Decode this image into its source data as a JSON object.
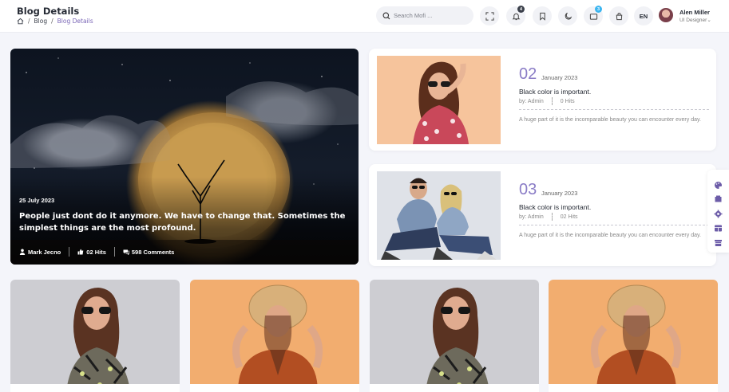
{
  "header": {
    "title": "Blog Details",
    "breadcrumb": [
      "Blog",
      "Blog Details"
    ],
    "search_placeholder": "Search Mofi ...",
    "notifications_count": "4",
    "cart_count": "3",
    "language": "EN",
    "user": {
      "name": "Alen Miller",
      "role": "UI Designer"
    }
  },
  "featured": {
    "date": "25 July 2023",
    "title": "People just dont do it anymore. We have to change that. Sometimes the simplest things are the most profound.",
    "author": "Mark Jecno",
    "hits": "02 Hits",
    "comments": "598 Comments"
  },
  "posts": [
    {
      "number": "02",
      "date": "January 2023",
      "title": "Black color is important.",
      "by": "by: Admin",
      "hits": "0 Hits",
      "description": "A huge part of it is the incomparable beauty you can encounter every day."
    },
    {
      "number": "03",
      "date": "January 2023",
      "title": "Black color is important.",
      "by": "by: Admin",
      "hits": "02 Hits",
      "description": "A huge part of it is the incomparable beauty you can encounter every day."
    }
  ],
  "colors": {
    "accent": "#8a7cc6",
    "badge_red": "#e84c5f",
    "badge_blue": "#3ab5f0"
  }
}
